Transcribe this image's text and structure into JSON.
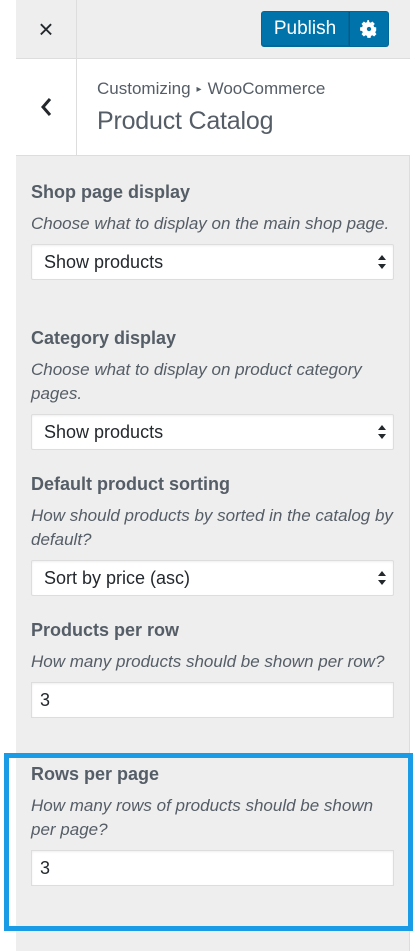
{
  "header": {
    "close_icon": "×",
    "publish_label": "Publish",
    "settings_icon": "gear-icon"
  },
  "section": {
    "breadcrumb_root": "Customizing",
    "breadcrumb_sep": "▸",
    "breadcrumb_current": "WooCommerce",
    "title": "Product Catalog"
  },
  "controls": {
    "shop_display": {
      "title": "Shop page display",
      "desc": "Choose what to display on the main shop page.",
      "value": "Show products"
    },
    "category_display": {
      "title": "Category display",
      "desc": "Choose what to display on product category pages.",
      "value": "Show products"
    },
    "default_sorting": {
      "title": "Default product sorting",
      "desc": "How should products by sorted in the catalog by default?",
      "value": "Sort by price (asc)"
    },
    "products_per_row": {
      "title": "Products per row",
      "desc": "How many products should be shown per row?",
      "value": "3"
    },
    "rows_per_page": {
      "title": "Rows per page",
      "desc": "How many rows of products should be shown per page?",
      "value": "3"
    }
  },
  "colors": {
    "accent": "#0073aa",
    "highlight": "#1a9be6"
  }
}
